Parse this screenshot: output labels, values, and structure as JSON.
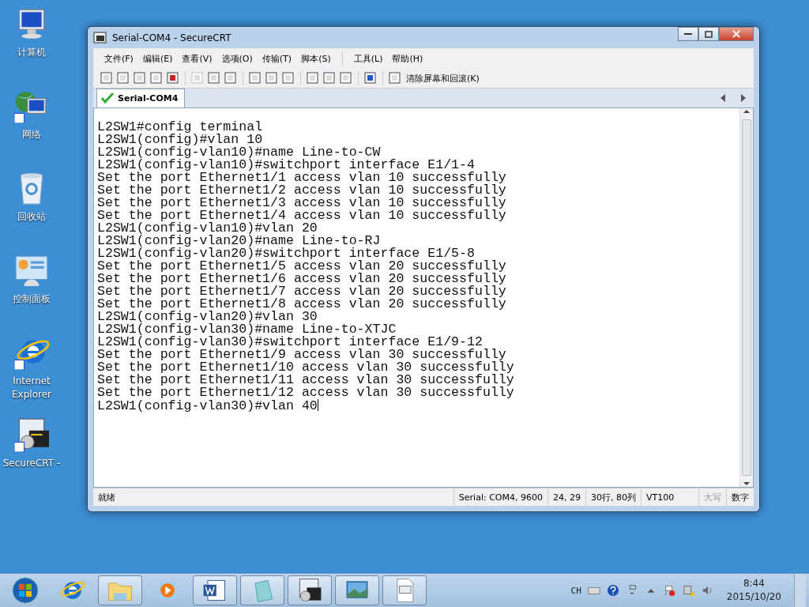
{
  "desktop_icons": [
    {
      "kind": "computer",
      "label": "计算机"
    },
    {
      "kind": "network",
      "label": "网络"
    },
    {
      "kind": "recycle",
      "label": "回收站"
    },
    {
      "kind": "control",
      "label": "控制面板"
    },
    {
      "kind": "ie",
      "label": "Internet Explorer"
    },
    {
      "kind": "securecrt",
      "label": "SecureCRT -"
    }
  ],
  "window": {
    "title": "Serial-COM4 - SecureCRT",
    "menu": [
      "文件(F)",
      "编辑(E)",
      "查看(V)",
      "选项(O)",
      "传输(T)",
      "脚本(S)",
      "工具(L)",
      "帮助(H)"
    ],
    "toolbar": {
      "clear_button": "清除屏幕和回滚(K)"
    },
    "tabs": [
      {
        "label": "Serial-COM4",
        "selected": true
      }
    ],
    "terminal": {
      "lines": [
        "L2SW1#config terminal",
        "L2SW1(config)#vlan 10",
        "L2SW1(config-vlan10)#name Line-to-CW",
        "L2SW1(config-vlan10)#switchport interface E1/1-4",
        "Set the port Ethernet1/1 access vlan 10 successfully",
        "Set the port Ethernet1/2 access vlan 10 successfully",
        "Set the port Ethernet1/3 access vlan 10 successfully",
        "Set the port Ethernet1/4 access vlan 10 successfully",
        "L2SW1(config-vlan10)#vlan 20",
        "L2SW1(config-vlan20)#name Line-to-RJ",
        "L2SW1(config-vlan20)#switchport interface E1/5-8",
        "Set the port Ethernet1/5 access vlan 20 successfully",
        "Set the port Ethernet1/6 access vlan 20 successfully",
        "Set the port Ethernet1/7 access vlan 20 successfully",
        "Set the port Ethernet1/8 access vlan 20 successfully",
        "L2SW1(config-vlan20)#vlan 30",
        "L2SW1(config-vlan30)#name Line-to-XTJC",
        "L2SW1(config-vlan30)#switchport interface E1/9-12",
        "Set the port Ethernet1/9 access vlan 30 successfully",
        "Set the port Ethernet1/10 access vlan 30 successfully",
        "Set the port Ethernet1/11 access vlan 30 successfully",
        "Set the port Ethernet1/12 access vlan 30 successfully",
        "L2SW1(config-vlan30)#vlan 40"
      ]
    },
    "status_bar": {
      "ready": "就绪",
      "connection": "Serial: COM4, 9600",
      "position": "24,  29",
      "size": "30行, 80列",
      "emulation": "VT100",
      "indicators": [
        {
          "label": "大写",
          "active": false
        },
        {
          "label": "数字",
          "active": true
        }
      ]
    }
  },
  "taskbar": {
    "apps": [
      {
        "kind": "start",
        "running": false
      },
      {
        "kind": "ie",
        "running": false
      },
      {
        "kind": "folder",
        "running": true
      },
      {
        "kind": "media",
        "running": false
      },
      {
        "kind": "word",
        "running": true
      },
      {
        "kind": "notepad",
        "running": true
      },
      {
        "kind": "securecrt",
        "running": true
      },
      {
        "kind": "photo",
        "running": true
      },
      {
        "kind": "document",
        "running": true
      }
    ],
    "tray": {
      "language": "CH",
      "time": "8:44",
      "date": "2015/10/20"
    }
  }
}
